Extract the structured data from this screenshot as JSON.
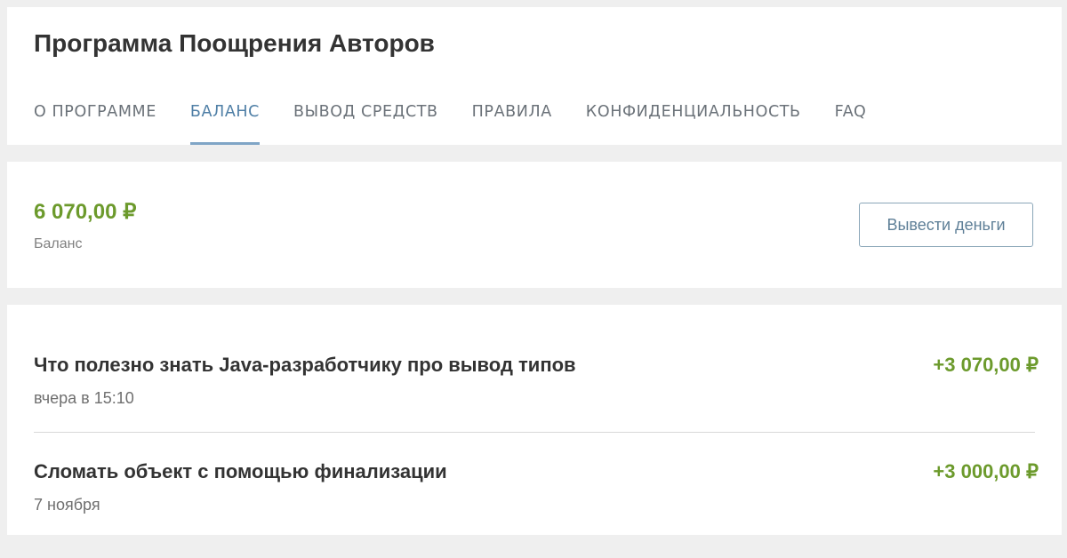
{
  "header": {
    "title": "Программа Поощрения Авторов",
    "tabs": [
      {
        "label": "О программе",
        "active": false
      },
      {
        "label": "Баланс",
        "active": true
      },
      {
        "label": "Вывод средств",
        "active": false
      },
      {
        "label": "Правила",
        "active": false
      },
      {
        "label": "Конфиденциальность",
        "active": false
      },
      {
        "label": "FAQ",
        "active": false
      }
    ]
  },
  "balance": {
    "amount": "6 070,00 ₽",
    "label": "Баланс",
    "withdraw_label": "Вывести деньги"
  },
  "transactions": [
    {
      "title": "Что полезно знать Java-разработчику про вывод типов",
      "date": "вчера в 15:10",
      "amount": "+3 070,00 ₽"
    },
    {
      "title": "Сломать объект с помощью финализации",
      "date": "7 ноября",
      "amount": "+3 000,00 ₽"
    }
  ],
  "colors": {
    "accent_green": "#6c9a2c",
    "active_tab": "#4f7fa6",
    "tab_underline": "#7fa5c6"
  }
}
